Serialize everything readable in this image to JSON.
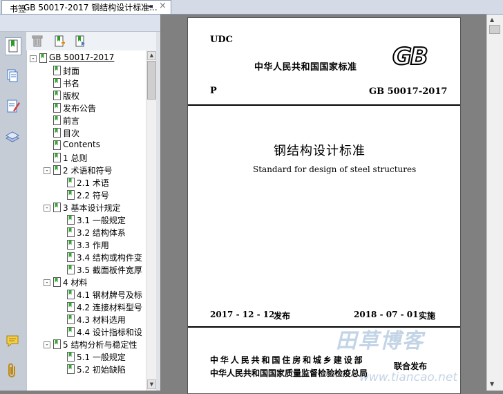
{
  "tab": {
    "title": "GB 50017-2017 钢结构设计标准...",
    "close": "×"
  },
  "panel": {
    "title": "书签",
    "collapse": "◂◂"
  },
  "tree": [
    {
      "label": "GB 50017-2017",
      "level": 0,
      "toggle": "-",
      "underline": true
    },
    {
      "label": "封面",
      "level": 1
    },
    {
      "label": "书名",
      "level": 1
    },
    {
      "label": "版权",
      "level": 1
    },
    {
      "label": "发布公告",
      "level": 1
    },
    {
      "label": "前言",
      "level": 1
    },
    {
      "label": "目次",
      "level": 1
    },
    {
      "label": "Contents",
      "level": 1
    },
    {
      "label": "1 总则",
      "level": 1
    },
    {
      "label": "2 术语和符号",
      "level": 1,
      "toggle": "-"
    },
    {
      "label": "2.1 术语",
      "level": 2
    },
    {
      "label": "2.2 符号",
      "level": 2
    },
    {
      "label": "3 基本设计规定",
      "level": 1,
      "toggle": "-"
    },
    {
      "label": "3.1 一般规定",
      "level": 2
    },
    {
      "label": "3.2 结构体系",
      "level": 2
    },
    {
      "label": "3.3 作用",
      "level": 2
    },
    {
      "label": "3.4 结构或构件变",
      "level": 2
    },
    {
      "label": "3.5 截面板件宽厚",
      "level": 2
    },
    {
      "label": "4 材料",
      "level": 1,
      "toggle": "-"
    },
    {
      "label": "4.1 钢材牌号及标",
      "level": 2
    },
    {
      "label": "4.2 连接材料型号",
      "level": 2
    },
    {
      "label": "4.3 材料选用",
      "level": 2
    },
    {
      "label": "4.4 设计指标和设",
      "level": 2
    },
    {
      "label": "5 结构分析与稳定性",
      "level": 1,
      "toggle": "-"
    },
    {
      "label": "5.1 一般规定",
      "level": 2
    },
    {
      "label": "5.2 初始缺陷",
      "level": 2
    }
  ],
  "page": {
    "udc": "UDC",
    "standard_header": "中华人民共和国国家标准",
    "gb_logo": "GB",
    "p_label": "P",
    "code": "GB 50017-2017",
    "title_cn": "钢结构设计标准",
    "title_en": "Standard for design of steel structures",
    "issue_date": "2017 - 12 - 12",
    "issue_label": "发布",
    "impl_date": "2018 - 07 - 01",
    "impl_label": "实施",
    "org1": "中华人民共和国住房和城乡建设部",
    "org2": "中华人民共和国国家质量监督检验检疫总局",
    "joint": "联合发布"
  },
  "watermark": {
    "text1": "田草博客",
    "text2": "www.tiancao.net"
  },
  "colors": {
    "accent": "#3c78c8",
    "bookmark_green": "#3aa23a",
    "panel_bg": "#dce3ee"
  },
  "icons": [
    "bookmarks-icon",
    "pages-icon",
    "annotations-icon",
    "layers-icon",
    "comment-icon",
    "attachment-icon",
    "delete-icon",
    "new-bookmark-icon",
    "expand-bookmark-icon"
  ]
}
